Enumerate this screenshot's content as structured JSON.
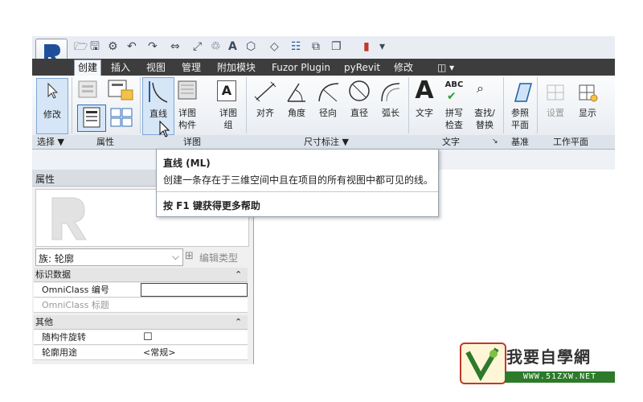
{
  "ribbon_tabs": [
    "创建",
    "插入",
    "视图",
    "管理",
    "附加模块",
    "Fuzor Plugin",
    "pyRevit",
    "修改"
  ],
  "buttons": {
    "modify": "修改",
    "line": "直线",
    "detail_component": [
      "详图",
      "构件"
    ],
    "detail_group": [
      "详图",
      "组"
    ],
    "aligned": "对齐",
    "angular": "角度",
    "radial": "径向",
    "diameter": "直径",
    "arc_length": "弧长",
    "text": "文字",
    "spelling": [
      "拼写",
      "检查"
    ],
    "find_replace": [
      "查找/",
      "替换"
    ],
    "reference_plane": [
      "参照",
      "平面"
    ],
    "set": "设置",
    "show": "显示",
    "abc": "ABC",
    "big_a": "A",
    "detail_group_a": "A"
  },
  "panels": {
    "select": "选择 ▼",
    "properties": "属性",
    "detail": "详图",
    "dimension": "尺寸标注 ▼",
    "text": "文字",
    "datum": "基准",
    "work_plane": "工作平面",
    "text_arrow": "↘"
  },
  "tooltip": {
    "title": "直线 (ML)",
    "description": "创建一条存在于三维空间中且在项目的所有视图中都可见的线。",
    "help": "按 F1 键获得更多帮助"
  },
  "properties": {
    "title": "属性",
    "family": "族: 轮廓",
    "edit_type": "编辑类型",
    "groups": [
      {
        "name": "标识数据",
        "collapse": "⌃",
        "rows": [
          {
            "label": "OmniClass 编号",
            "value": ""
          },
          {
            "label": "OmniClass 标题",
            "value": ""
          }
        ]
      },
      {
        "name": "其他",
        "collapse": "⌃",
        "rows": [
          {
            "label": "随构件旋转",
            "value": "☐"
          },
          {
            "label": "轮廓用途",
            "value": "<常规>"
          }
        ]
      }
    ]
  },
  "logo": {
    "title": "我要自學網",
    "url": "WWW.51ZXW.NET"
  },
  "colors": {
    "accent": "#3d6fb6",
    "tabbar": "#3d3d3d",
    "logo_green": "#2c7a2a",
    "logo_red": "#c0392b"
  }
}
